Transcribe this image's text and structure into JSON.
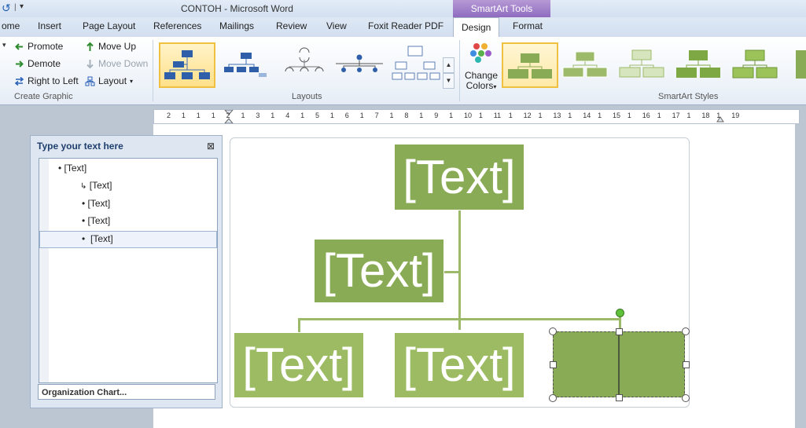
{
  "window": {
    "doc_name": "CONTOH",
    "dash": "-",
    "app_name": "Microsoft Word",
    "context_tab": "SmartArt Tools"
  },
  "tabs": [
    "ome",
    "Insert",
    "Page Layout",
    "References",
    "Mailings",
    "Review",
    "View",
    "Foxit Reader PDF",
    "Design",
    "Format"
  ],
  "active_tab": "Design",
  "create_graphic": {
    "label": "Create Graphic",
    "promote": "Promote",
    "demote": "Demote",
    "right_to_left": "Right to Left",
    "move_up": "Move Up",
    "move_down": "Move Down",
    "layout": "Layout"
  },
  "layouts": {
    "label": "Layouts"
  },
  "change_colors": {
    "line1": "Change",
    "line2": "Colors"
  },
  "smartart_styles": {
    "label": "SmartArt Styles"
  },
  "ruler_numbers": [
    "2",
    "1",
    "1",
    "1",
    "2",
    "1",
    "3",
    "1",
    "4",
    "1",
    "5",
    "1",
    "6",
    "1",
    "7",
    "1",
    "8",
    "1",
    "9",
    "1",
    "10",
    "1",
    "11",
    "1",
    "12",
    "1",
    "13",
    "1",
    "14",
    "1",
    "15",
    "1",
    "16",
    "1",
    "17",
    "1",
    "18",
    "1",
    "19"
  ],
  "text_pane": {
    "title": "Type your text here",
    "close": "⊠",
    "items": [
      "[Text]",
      "[Text]",
      "[Text]",
      "[Text]",
      "[Text]"
    ],
    "footer": "Organization Chart..."
  },
  "diagram": {
    "top": "[Text]",
    "assistant": "[Text]",
    "child1": "[Text]",
    "child2": "[Text]",
    "child3": ""
  },
  "colors": {
    "box": "#8aab55",
    "line": "#9dba6a",
    "context_tab": "#8f6bbf"
  }
}
